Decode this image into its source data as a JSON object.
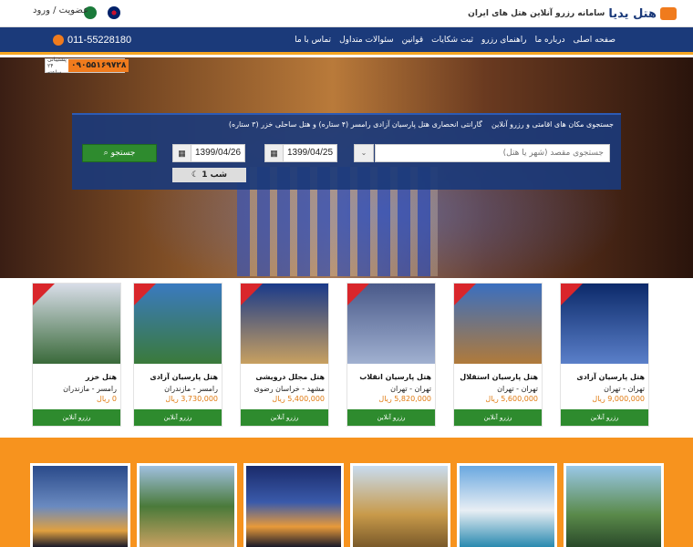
{
  "header": {
    "brand": "هتل یدیا",
    "tagline": "سامانه رزرو آنلاین هتل های ایران",
    "auth_label": "عضویت / ورود"
  },
  "nav": {
    "items": [
      {
        "label": "صفحه اصلی"
      },
      {
        "label": "درباره ما"
      },
      {
        "label": "راهنمای رزرو"
      },
      {
        "label": "ثبت شکایات"
      },
      {
        "label": "قوانین"
      },
      {
        "label": "سئوالات متداول"
      },
      {
        "label": "تماس با ما"
      }
    ],
    "phone": "011-55228180"
  },
  "hero": {
    "support_number": "۰۹۰۵۵۱۶۹۷۲۸",
    "support_label": "پشتیبانی ۲۴ ساعته"
  },
  "search": {
    "title": "جستجوی مکان های اقامتی و رزرو آنلاین",
    "guarantee": "گارانتی انحصاری هتل پارسیان آزادی رامسر (۴ ستاره) و هتل ساحلی خزر (۳ ستاره)",
    "destination_placeholder": "جستجوی مقصد (شهر یا هتل)",
    "check_in": "1399/04/25",
    "check_out": "1399/04/26",
    "button_label": "جستجو",
    "nights_label": "1 شب"
  },
  "hotels": [
    {
      "name": "هتل پارسیان آزادی",
      "city": "تهران - تهران",
      "price": "9,000,000 ریال",
      "button": "رزرو آنلاین",
      "color1": "#0c2a6a",
      "color2": "#5a7fc9"
    },
    {
      "name": "هتل پارسیان استقلال",
      "city": "تهران - تهران",
      "price": "5,600,000 ریال",
      "button": "رزرو آنلاین",
      "color1": "#3a6fc0",
      "color2": "#b07a3a"
    },
    {
      "name": "هتل پارسیان انقلاب",
      "city": "تهران - تهران",
      "price": "5,820,000 ریال",
      "button": "رزرو آنلاین",
      "color1": "#4a5a8a",
      "color2": "#a0b0d0"
    },
    {
      "name": "هتل مجلل درویشی",
      "city": "مشهد - خراسان رضوی",
      "price": "5,400,000 ریال",
      "button": "رزرو آنلاین",
      "color1": "#1a3a8a",
      "color2": "#c8a060"
    },
    {
      "name": "هتل پارسیان آزادی",
      "city": "رامسر - مازندران",
      "price": "3,730,000 ریال",
      "button": "رزرو آنلاین",
      "color1": "#3a7ac0",
      "color2": "#3a7a3a"
    },
    {
      "name": "هتل خزر",
      "city": "رامسر - مازندران",
      "price": "0 ریال",
      "button": "رزرو آنلاین",
      "color1": "#d8dde8",
      "color2": "#3a6a3a"
    }
  ],
  "colors": {
    "brand_blue": "#1b3a7a",
    "accent_orange": "#f7931e",
    "button_green": "#2e8b2e",
    "ribbon_red": "#d9262b"
  }
}
